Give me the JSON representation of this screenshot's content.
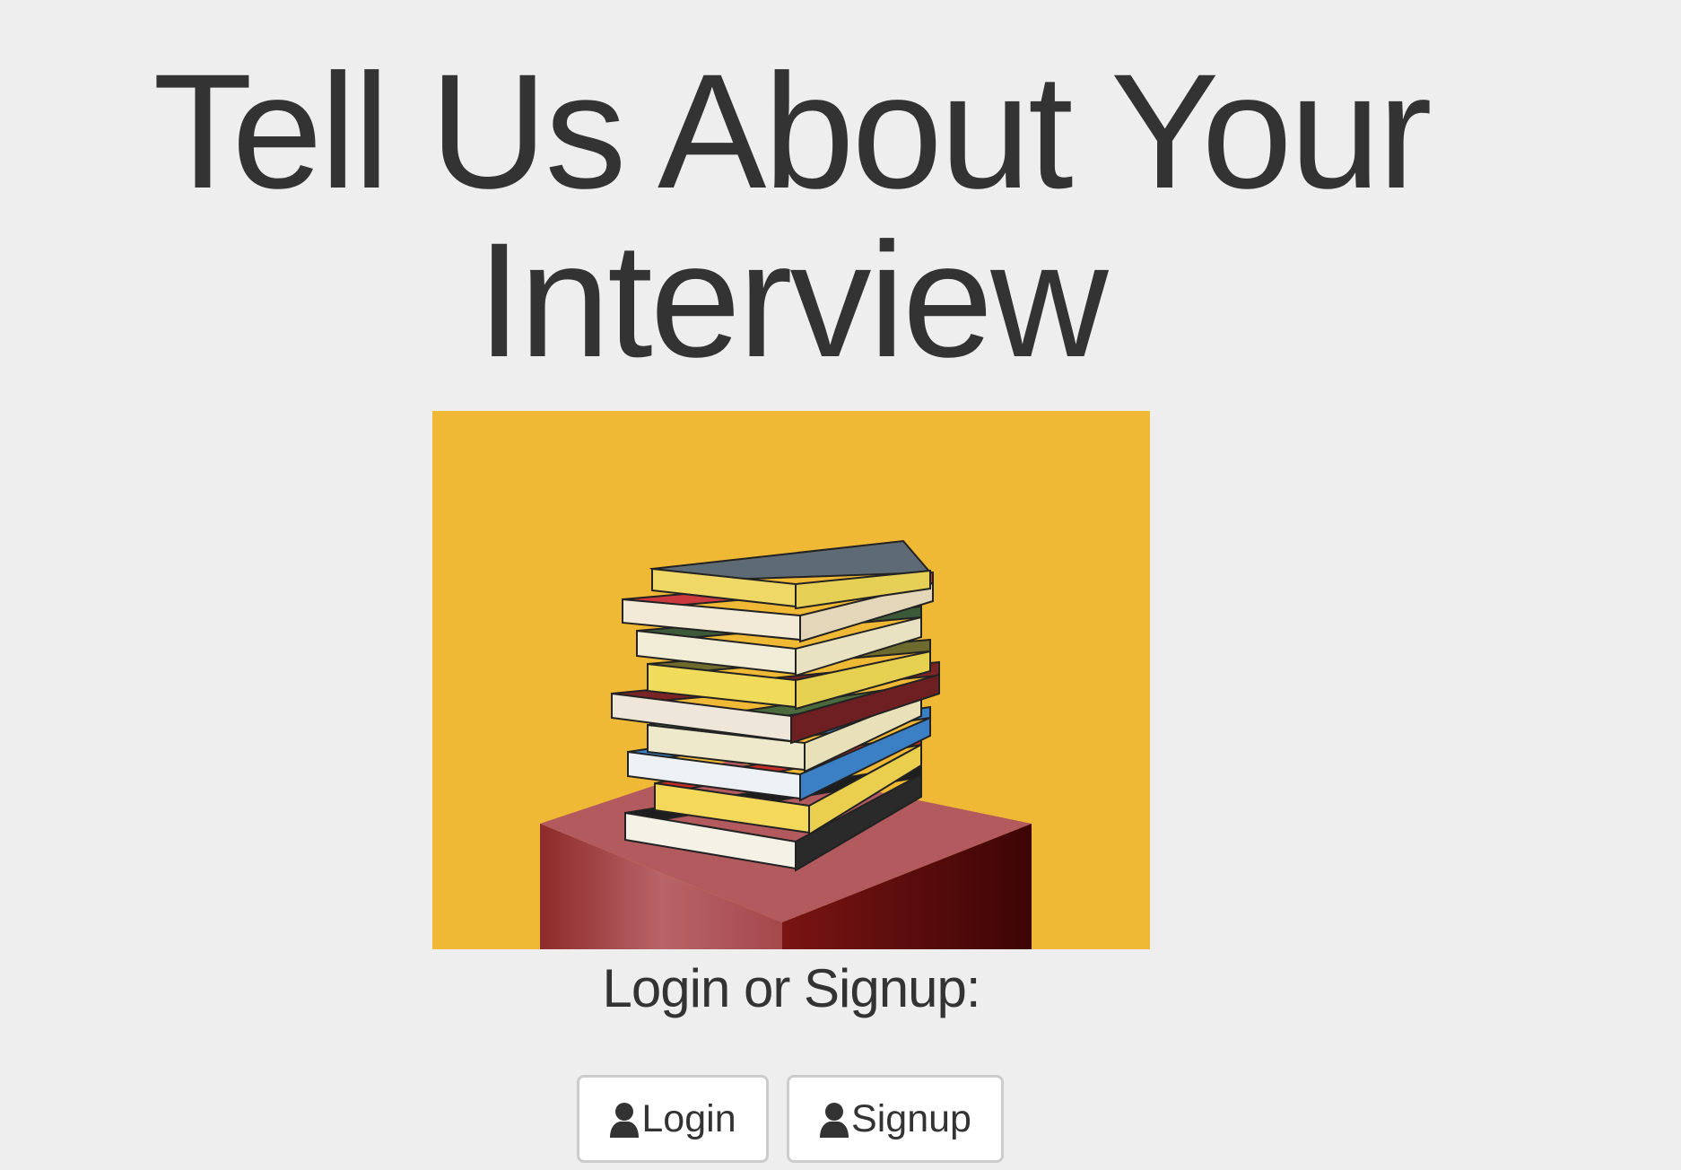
{
  "page": {
    "title": "Tell Us About Your Interview",
    "prompt": "Login or Signup:"
  },
  "hero": {
    "image_description_icon": "stack-of-books-on-pedestal",
    "background_color": "#f0b935"
  },
  "auth": {
    "login_label": "Login",
    "signup_label": "Signup",
    "icon": "user-icon"
  },
  "colors": {
    "page_background": "#eeeeee",
    "text": "#333333",
    "button_border": "#cccccc"
  }
}
